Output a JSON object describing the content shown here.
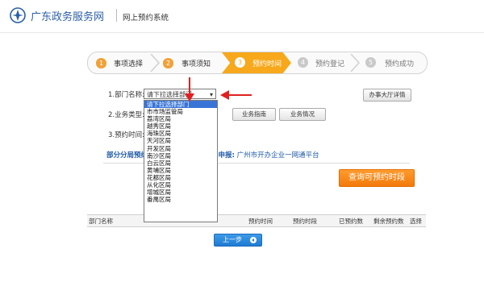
{
  "header": {
    "site_title": "广东政务服务网",
    "system_title": "网上预约系统"
  },
  "steps": [
    {
      "num": "1",
      "label": "事项选择",
      "state": "done"
    },
    {
      "num": "2",
      "label": "事项须知",
      "state": "done"
    },
    {
      "num": "3",
      "label": "预约时间",
      "state": "current"
    },
    {
      "num": "4",
      "label": "预约登记",
      "state": "todo"
    },
    {
      "num": "5",
      "label": "预约成功",
      "state": "todo"
    }
  ],
  "form": {
    "dept_label_num": "1.",
    "dept_label": "部门名称:",
    "dept_selected": "请下拉选择部门",
    "type_label_num": "2.",
    "type_label": "业务类型:",
    "time_label_num": "3.",
    "time_label": "预约时间:",
    "hall_button": "办事大厅详情",
    "guide_button": "业务指南",
    "status_button": "业务情况",
    "notice_left": "部分分局预约",
    "notice_right_prefix": "上申报:",
    "notice_right_link": "广州市开办企业一网通平台",
    "query_button": "查询可预约时段"
  },
  "dropdown_options": [
    "请下拉选择部门",
    "市市场监管局",
    "荔湾区局",
    "越秀区局",
    "海珠区局",
    "天河区局",
    "开发区局",
    "南沙区局",
    "白云区局",
    "黄埔区局",
    "花都区局",
    "从化区局",
    "增城区局",
    "番禺区局"
  ],
  "table": {
    "columns": [
      "部门名称",
      "预约时间",
      "预约时段",
      "已预约数",
      "剩余预约数",
      "选择"
    ]
  },
  "back_button": "上一步",
  "colors": {
    "brand_blue": "#2a5fa8",
    "step_active": "#f7a81b",
    "query_orange": "#f37a0b",
    "arrow_red": "#e02020",
    "selected_option": "#3875d7"
  }
}
